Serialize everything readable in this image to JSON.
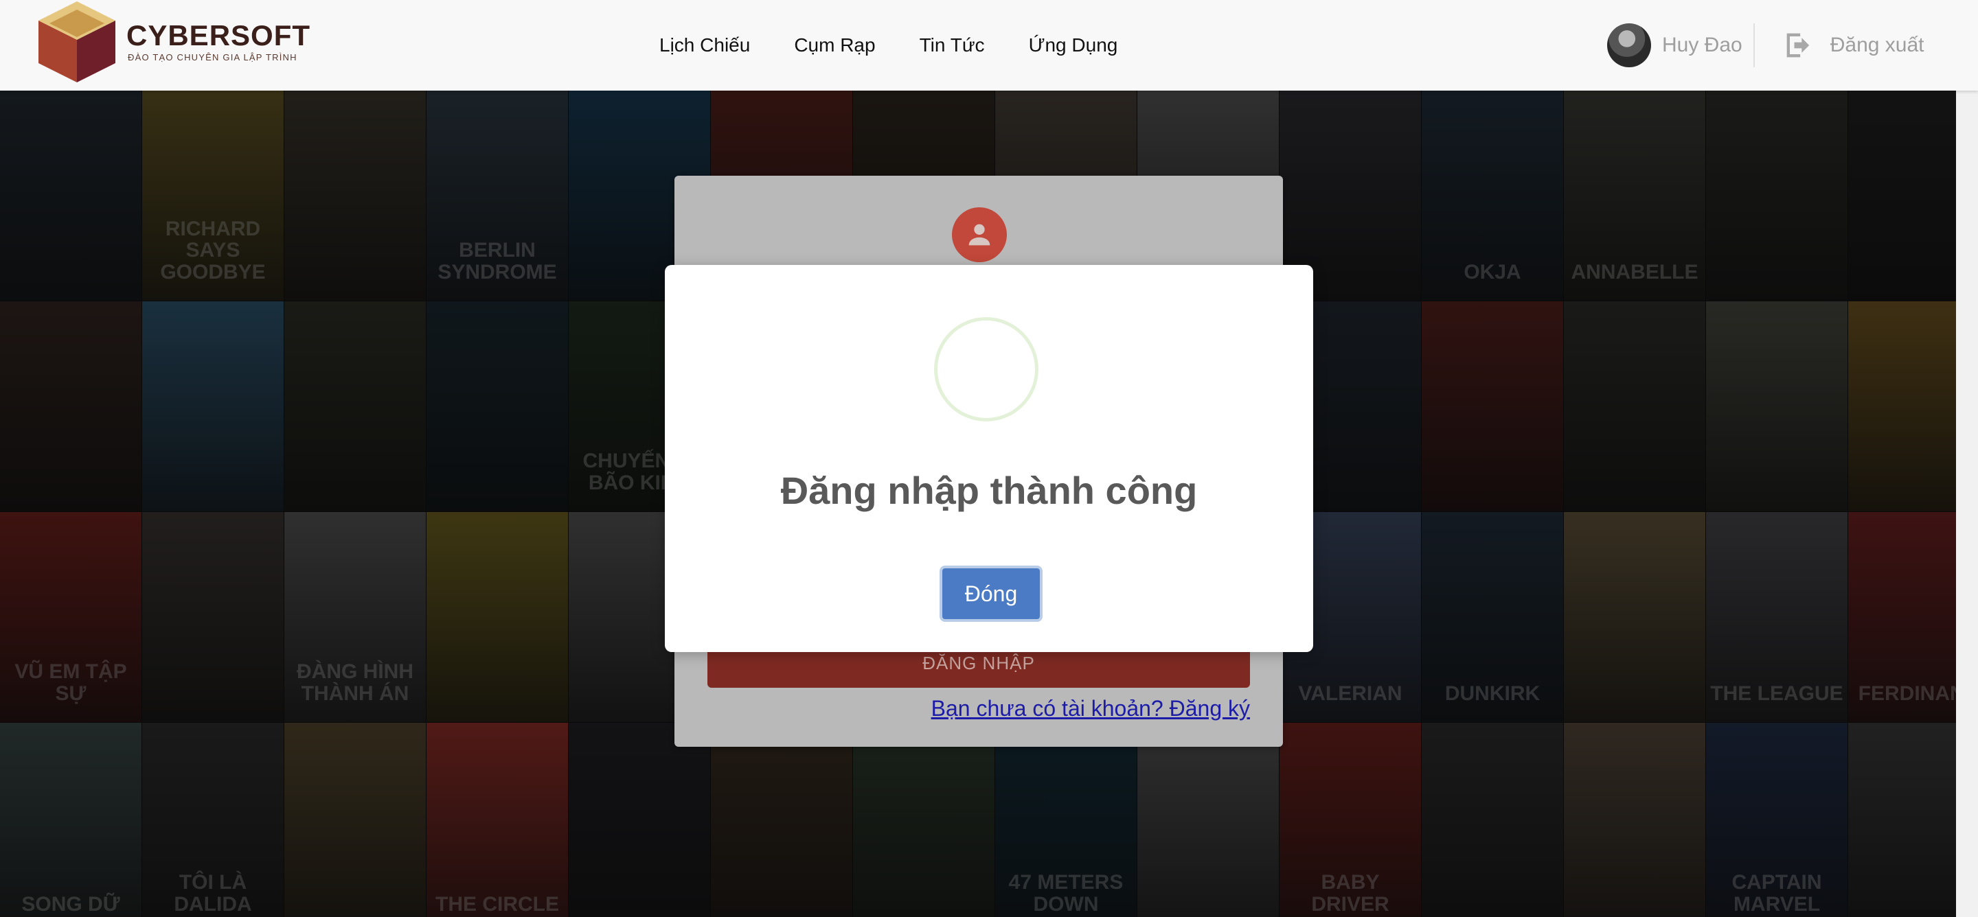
{
  "brand": {
    "name": "CYBERSOFT",
    "tagline": "ĐÀO TẠO CHUYÊN GIA LẬP TRÌNH",
    "colors": {
      "cube_top": "#d8b26a",
      "cube_side": "#8e2a32",
      "text": "#3a1f1a"
    }
  },
  "nav": {
    "items": [
      {
        "label": "Lịch Chiếu"
      },
      {
        "label": "Cụm Rạp"
      },
      {
        "label": "Tin Tức"
      },
      {
        "label": "Ứng Dụng"
      }
    ]
  },
  "user": {
    "name": "Huy Đao",
    "logout_label": "Đăng xuất",
    "avatar_icon": "user-avatar",
    "logout_icon": "sign-out-icon"
  },
  "posters": [
    {
      "title": "",
      "color": "#2c3640"
    },
    {
      "title": "Richard Says Goodbye",
      "color": "#7a6a2e"
    },
    {
      "title": "",
      "color": "#4a4438"
    },
    {
      "title": "Berlin Syndrome",
      "color": "#3a4a58"
    },
    {
      "title": "",
      "color": "#1f4a6a"
    },
    {
      "title": "",
      "color": "#6a2a24"
    },
    {
      "title": "",
      "color": "#3a3026"
    },
    {
      "title": "",
      "color": "#5a5046"
    },
    {
      "title": "",
      "color": "#6a6c6a"
    },
    {
      "title": "",
      "color": "#3a3a40"
    },
    {
      "title": "Okja",
      "color": "#2a3a4a"
    },
    {
      "title": "Annabelle",
      "color": "#4a4a44"
    },
    {
      "title": "",
      "color": "#3a3a36"
    },
    {
      "title": "",
      "color": "#2a2a2a"
    },
    {
      "title": "",
      "color": "#40302a"
    },
    {
      "title": "",
      "color": "#3a6a8a"
    },
    {
      "title": "",
      "color": "#3a3c30"
    },
    {
      "title": "",
      "color": "#22343e"
    },
    {
      "title": "Chuyến đi bão kinh",
      "color": "#2a3a2a"
    },
    {
      "title": "",
      "color": "#52463c"
    },
    {
      "title": "",
      "color": "#4a3422"
    },
    {
      "title": "",
      "color": "#4a3a3a"
    },
    {
      "title": "",
      "color": "#3a3026"
    },
    {
      "title": "",
      "color": "#2a3440"
    },
    {
      "title": "",
      "color": "#6a2a26"
    },
    {
      "title": "",
      "color": "#3a3a36"
    },
    {
      "title": "",
      "color": "#5a5a50"
    },
    {
      "title": "",
      "color": "#8a6a2a"
    },
    {
      "title": "Vũ Em Tập Sự",
      "color": "#8a2a24"
    },
    {
      "title": "",
      "color": "#4a4440"
    },
    {
      "title": "Đàng Hình Thành Án",
      "color": "#6a6a6a"
    },
    {
      "title": "",
      "color": "#8a7a2a"
    },
    {
      "title": "",
      "color": "#6a6a6a"
    },
    {
      "title": "",
      "color": "#2a3a4a"
    },
    {
      "title": "",
      "color": "#3a4a5a"
    },
    {
      "title": "",
      "color": "#4a4a4a"
    },
    {
      "title": "",
      "color": "#2a4a7a"
    },
    {
      "title": "Valerian",
      "color": "#4a5a7a"
    },
    {
      "title": "Dunkirk",
      "color": "#2a3a4a"
    },
    {
      "title": "",
      "color": "#7a6a4a"
    },
    {
      "title": "The League",
      "color": "#5a5a60"
    },
    {
      "title": "Ferdinand",
      "color": "#8a2a2a"
    },
    {
      "title": "Song Dữ",
      "color": "#4a5a5a"
    },
    {
      "title": "Tôi là Dalida",
      "color": "#3a3a3a"
    },
    {
      "title": "",
      "color": "#6a5a3a"
    },
    {
      "title": "The Circle",
      "color": "#b43a32"
    },
    {
      "title": "",
      "color": "#2a2a30"
    },
    {
      "title": "",
      "color": "#4a3a2a"
    },
    {
      "title": "",
      "color": "#3a4a3a"
    },
    {
      "title": "47 Meters Down",
      "color": "#1a3a4a"
    },
    {
      "title": "",
      "color": "#6a6a6a"
    },
    {
      "title": "Baby Driver",
      "color": "#8a2a24"
    },
    {
      "title": "",
      "color": "#3a3a3a"
    },
    {
      "title": "",
      "color": "#6a5a4a"
    },
    {
      "title": "Captain Marvel",
      "color": "#2a3a5a"
    },
    {
      "title": "",
      "color": "#4a4a4a"
    }
  ],
  "login": {
    "submit_label": "ĐĂNG NHẬP",
    "register_link": "Bạn chưa có tài khoản? Đăng ký",
    "icon": "user-icon"
  },
  "modal": {
    "title": "Đăng nhập thành công",
    "close_label": "Đóng",
    "icon": "success-check-icon"
  }
}
